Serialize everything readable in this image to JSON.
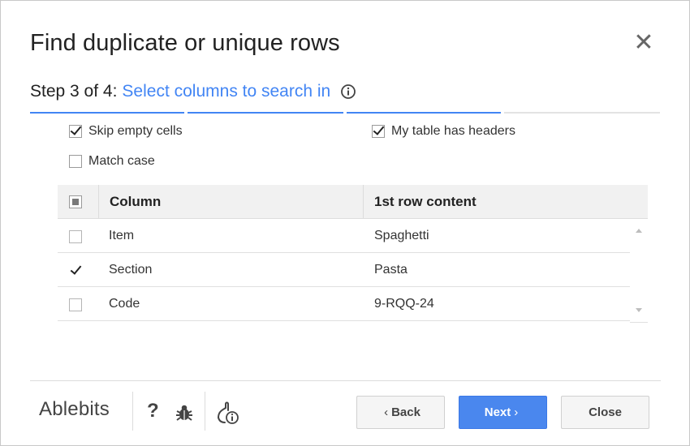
{
  "dialog": {
    "title": "Find duplicate or unique rows",
    "close_glyph": "✕"
  },
  "step": {
    "prefix": "Step 3 of 4:",
    "label": "Select columns to search in",
    "total_steps": 4,
    "current_step": 3
  },
  "options": {
    "skip_empty": {
      "label": "Skip empty cells",
      "checked": true
    },
    "headers": {
      "label": "My table has headers",
      "checked": true
    },
    "match_case": {
      "label": "Match case",
      "checked": false
    }
  },
  "table": {
    "headers": {
      "column": "Column",
      "content": "1st row content"
    },
    "rows": [
      {
        "column": "Item",
        "content": "Spaghetti",
        "checked": false
      },
      {
        "column": "Section",
        "content": "Pasta",
        "checked": true
      },
      {
        "column": "Code",
        "content": "9-RQQ-24",
        "checked": false
      }
    ]
  },
  "footer": {
    "brand": "Ablebits",
    "help": "?",
    "back_label": "Back",
    "next_label": "Next",
    "close_label": "Close",
    "back_chevron": "‹",
    "next_chevron": "›"
  },
  "colors": {
    "accent": "#4285f4",
    "next_button": "#4a87ee"
  }
}
